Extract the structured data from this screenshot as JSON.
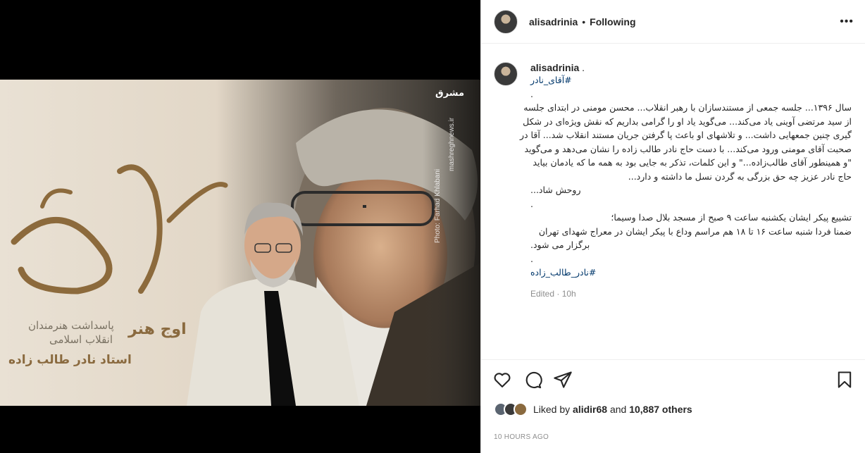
{
  "post": {
    "username": "alisadrinia",
    "dot": "•",
    "follow_status": "Following",
    "more_label": "•••",
    "media_alt": "Portrait of an elderly man in front of a poster",
    "poster": {
      "title_calligraphy": "آقای نادر",
      "subtitle1": "اوج هنر",
      "subtitle2": "پاسداشت هنرمندان",
      "subtitle3": "انقلاب اسلامی",
      "subtitle4": "استاد نادر طالب زاده",
      "credit": "Photo: Farhad Khlabani",
      "site": "mashreghnews.ir",
      "logo": "مشرق"
    }
  },
  "caption": {
    "username": "alisadrinia",
    "user_suffix": ".",
    "tag_top": "#آقای_نادر",
    "lines": [
      ".",
      "سال ۱۳۹۶... جلسه جمعی از مستندسازان با رهبر انقلاب... محسن مومنی در ابتدای جلسه",
      "از سید مرتضی آوینی یاد می‌کند... می‌گوید یاد او را گرامی بداریم که نقش ویژه‌ای در شکل",
      "گیری چنین جمعهایی داشت... و تلاشهای او باعث پا گرفتن جریان مستند انقلاب شد... آقا در",
      "صحبت آقای مومنی ورود می‌کند... با دست حاج نادر طالب زاده را نشان می‌دهد و می‌گوید",
      "\"و همینطور آقای طالب‌زاده...\" و این کلمات، تذکر به جایی بود به همه ما که یادمان بیاید",
      "حاج نادر عزیز چه حق بزرگی به گردن نسل ما داشته و دارد...",
      "روحش شاد...",
      ".",
      "تشییع پیکر ایشان یکشنبه ساعت ۹ صبح از مسجد بلال صدا وسیما؛",
      "ضمنا فردا شنبه ساعت ۱۶ تا ۱۸ هم مراسم وداع با پیکر ایشان در معراج شهدای تهران",
      "برگزار می شود.",
      "."
    ],
    "tag_bottom": "#نادر_طالب_زاده",
    "edited": "Edited · 10h"
  },
  "likes": {
    "prefix": "Liked by ",
    "user": "alidir68",
    "middle": " and ",
    "count": "10,887 others"
  },
  "time_ago": "10 HOURS AGO",
  "icons": [
    "heart-icon",
    "comment-icon",
    "share-icon",
    "save-icon"
  ]
}
